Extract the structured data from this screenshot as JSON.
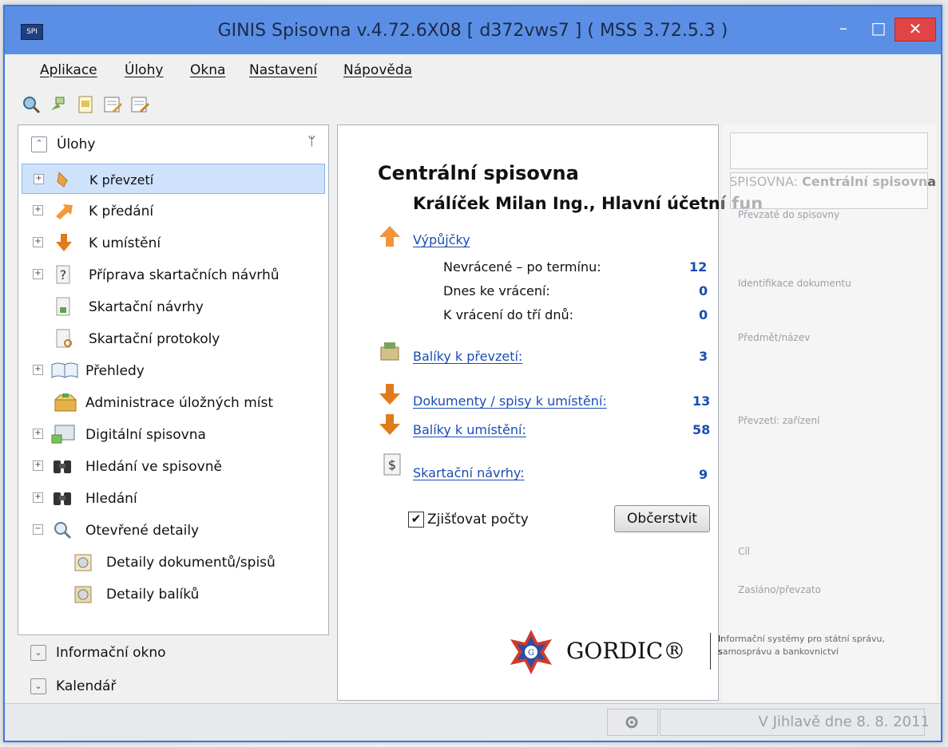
{
  "window": {
    "app_icon_text": "SPI",
    "title": "GINIS Spisovna v.4.72.6X08 [ d372vws7 ] ( MSS 3.72.5.3 )",
    "controls": {
      "minimize": "–",
      "maximize": "□",
      "close": "✕"
    }
  },
  "menu": [
    "Aplikace",
    "Úlohy",
    "Okna",
    "Nastavení",
    "Nápověda"
  ],
  "toolbar": {
    "icons": [
      "search-magnifier-icon",
      "pin-icon",
      "document-icon",
      "list-edit-icon",
      "list-check-icon"
    ],
    "context_label": "SPISOVNA:",
    "context_value": "Centrální spisovna"
  },
  "tasks_panel": {
    "title": "Úlohy",
    "pin": "ᛘ",
    "items": [
      {
        "label": "K převzetí",
        "expandable": true,
        "icon": "hand-arrow-icon",
        "selected": true
      },
      {
        "label": "K předání",
        "expandable": true,
        "icon": "arrow-right-icon"
      },
      {
        "label": "K umístění",
        "expandable": true,
        "icon": "arrow-down-icon"
      },
      {
        "label": "Příprava skartačních návrhů",
        "expandable": true,
        "icon": "question-document-icon"
      },
      {
        "label": "Skartační návrhy",
        "expandable": false,
        "icon": "document-icon"
      },
      {
        "label": "Skartační protokoly",
        "expandable": false,
        "icon": "document-search-icon"
      },
      {
        "label": "Přehledy",
        "expandable": true,
        "icon": "book-icon"
      },
      {
        "label": "Administrace úložných míst",
        "expandable": false,
        "icon": "box-icon"
      },
      {
        "label": "Digitální spisovna",
        "expandable": true,
        "icon": "digital-archive-icon"
      },
      {
        "label": "Hledání ve spisovně",
        "expandable": true,
        "icon": "binoculars-icon"
      },
      {
        "label": "Hledání",
        "expandable": true,
        "icon": "binoculars-icon"
      },
      {
        "label": "Otevřené detaily",
        "expandable": true,
        "expanded": true,
        "icon": "magnifier-icon"
      },
      {
        "label": "Detaily dokumentů/spisů",
        "expandable": false,
        "child": true,
        "icon": "detail-document-icon"
      },
      {
        "label": "Detaily balíků",
        "expandable": false,
        "child": true,
        "icon": "detail-package-icon"
      }
    ],
    "bottom_sections": [
      "Informační okno",
      "Kalendář"
    ]
  },
  "main": {
    "title": "Centrální spisovna",
    "subtitle": "Králíček Milan  Ing., Hlavní účetní fun",
    "sections": [
      {
        "label": "Výpůjčky",
        "link": true,
        "icon": "arrow-up-icon"
      },
      {
        "label": "Nevrácené – po termínu:",
        "value": "12"
      },
      {
        "label": "Dnes ke vrácení:",
        "value": "0"
      },
      {
        "label": "K vrácení do tří dnů:",
        "value": "0"
      },
      {
        "label": "Balíky k převzetí:",
        "value": "3",
        "link": true,
        "icon": "package-icon"
      },
      {
        "label": "Dokumenty / spisy k umístění:",
        "value": "13",
        "link": true,
        "icon": "arrow-down-icon"
      },
      {
        "label": "Balíky k umístění:",
        "value": "58",
        "link": true,
        "icon": "arrow-down-icon"
      },
      {
        "label": "Skartační návrhy:",
        "value": "9",
        "link": true,
        "icon": "dollar-document-icon"
      }
    ],
    "checkbox": {
      "label": "Zjišťovat počty",
      "checked": true,
      "mark": "✔"
    },
    "refresh_button": "Občerstvit",
    "logo": {
      "name": "GORDIC®",
      "tagline": "Informační systémy pro státní správu, samosprávu a bankovnictví"
    }
  },
  "statusbar": {
    "icon": "settings-gear-icon",
    "text": "V Jihlavě dne 8. 8. 2011"
  },
  "right_pane": {
    "rows": [
      "Identifikace dokumentu",
      "Převzetí: zařízení",
      "Převzaté do spisovny",
      "Předmět/název",
      "Cíl",
      "Zasláno/převzato"
    ]
  },
  "colors": {
    "titlebar": "#5b8fe6",
    "link": "#1a4db3",
    "selection": "#cfe2fb",
    "close_button": "#e04444"
  }
}
